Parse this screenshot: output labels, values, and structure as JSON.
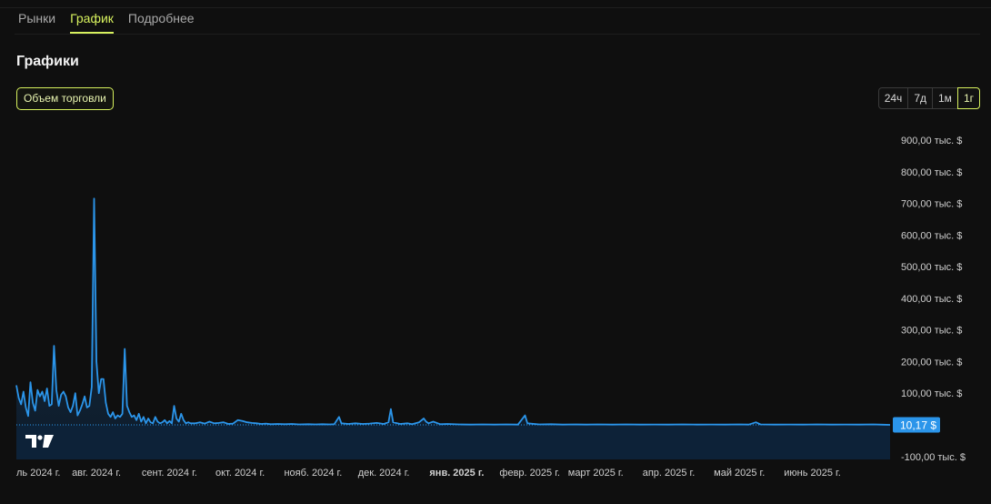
{
  "tabs": [
    {
      "label": "Рынки",
      "active": false
    },
    {
      "label": "График",
      "active": true
    },
    {
      "label": "Подробнее",
      "active": false
    }
  ],
  "section_title": "Графики",
  "metric_button": "Объем торговли",
  "ranges": [
    {
      "label": "24ч",
      "active": false
    },
    {
      "label": "7д",
      "active": false
    },
    {
      "label": "1м",
      "active": false
    },
    {
      "label": "1г",
      "active": true
    }
  ],
  "colors": {
    "accent": "#d7f15e",
    "line": "#2b95ea",
    "badge": "#2b95ea"
  },
  "chart_data": {
    "type": "area",
    "ylim": [
      -100000,
      950000
    ],
    "y_ticks": [
      {
        "value": 900000,
        "label": "900,00 тыс. $"
      },
      {
        "value": 800000,
        "label": "800,00 тыс. $"
      },
      {
        "value": 700000,
        "label": "700,00 тыс. $"
      },
      {
        "value": 600000,
        "label": "600,00 тыс. $"
      },
      {
        "value": 500000,
        "label": "500,00 тыс. $"
      },
      {
        "value": 400000,
        "label": "400,00 тыс. $"
      },
      {
        "value": 300000,
        "label": "300,00 тыс. $"
      },
      {
        "value": 200000,
        "label": "200,00 тыс. $"
      },
      {
        "value": 100000,
        "label": "100,00 тыс. $"
      },
      {
        "value": -100000,
        "label": "-100,00 тыс. $"
      }
    ],
    "x_ticks": [
      {
        "date": "2024-07-01",
        "label": "ль 2024 г.",
        "bold": false
      },
      {
        "date": "2024-08-01",
        "label": "авг. 2024 г.",
        "bold": false
      },
      {
        "date": "2024-09-01",
        "label": "сент. 2024 г.",
        "bold": false
      },
      {
        "date": "2024-10-01",
        "label": "окт. 2024 г.",
        "bold": false
      },
      {
        "date": "2024-11-01",
        "label": "нояб. 2024 г.",
        "bold": false
      },
      {
        "date": "2024-12-01",
        "label": "дек. 2024 г.",
        "bold": false
      },
      {
        "date": "2025-01-01",
        "label": "янв. 2025 г.",
        "bold": true
      },
      {
        "date": "2025-02-01",
        "label": "февр. 2025 г.",
        "bold": false
      },
      {
        "date": "2025-03-01",
        "label": "март 2025 г.",
        "bold": false
      },
      {
        "date": "2025-04-01",
        "label": "апр. 2025 г.",
        "bold": false
      },
      {
        "date": "2025-05-01",
        "label": "май 2025 г.",
        "bold": false
      },
      {
        "date": "2025-06-01",
        "label": "июнь 2025 г.",
        "bold": false
      }
    ],
    "last_value_label": "10,17 $",
    "last_value": 10.17,
    "series": [
      {
        "unit": "$",
        "points": [
          [
            "2024-06-28",
            125000
          ],
          [
            "2024-06-29",
            85000
          ],
          [
            "2024-06-30",
            65000
          ],
          [
            "2024-07-01",
            105000
          ],
          [
            "2024-07-02",
            55000
          ],
          [
            "2024-07-03",
            28000
          ],
          [
            "2024-07-04",
            135000
          ],
          [
            "2024-07-05",
            70000
          ],
          [
            "2024-07-06",
            45000
          ],
          [
            "2024-07-07",
            110000
          ],
          [
            "2024-07-08",
            90000
          ],
          [
            "2024-07-09",
            105000
          ],
          [
            "2024-07-10",
            75000
          ],
          [
            "2024-07-11",
            115000
          ],
          [
            "2024-07-12",
            60000
          ],
          [
            "2024-07-13",
            65000
          ],
          [
            "2024-07-14",
            250000
          ],
          [
            "2024-07-15",
            110000
          ],
          [
            "2024-07-16",
            60000
          ],
          [
            "2024-07-17",
            95000
          ],
          [
            "2024-07-18",
            105000
          ],
          [
            "2024-07-19",
            90000
          ],
          [
            "2024-07-20",
            55000
          ],
          [
            "2024-07-21",
            40000
          ],
          [
            "2024-07-22",
            60000
          ],
          [
            "2024-07-23",
            100000
          ],
          [
            "2024-07-24",
            30000
          ],
          [
            "2024-07-25",
            45000
          ],
          [
            "2024-07-26",
            65000
          ],
          [
            "2024-07-27",
            90000
          ],
          [
            "2024-07-28",
            55000
          ],
          [
            "2024-07-29",
            60000
          ],
          [
            "2024-07-30",
            120000
          ],
          [
            "2024-07-31",
            715000
          ],
          [
            "2024-08-01",
            200000
          ],
          [
            "2024-08-02",
            100000
          ],
          [
            "2024-08-03",
            145000
          ],
          [
            "2024-08-04",
            145000
          ],
          [
            "2024-08-05",
            70000
          ],
          [
            "2024-08-06",
            35000
          ],
          [
            "2024-08-07",
            25000
          ],
          [
            "2024-08-08",
            40000
          ],
          [
            "2024-08-09",
            20000
          ],
          [
            "2024-08-10",
            30000
          ],
          [
            "2024-08-11",
            25000
          ],
          [
            "2024-08-12",
            35000
          ],
          [
            "2024-08-13",
            240000
          ],
          [
            "2024-08-14",
            60000
          ],
          [
            "2024-08-15",
            40000
          ],
          [
            "2024-08-16",
            25000
          ],
          [
            "2024-08-17",
            30000
          ],
          [
            "2024-08-18",
            15000
          ],
          [
            "2024-08-19",
            35000
          ],
          [
            "2024-08-20",
            10000
          ],
          [
            "2024-08-21",
            25000
          ],
          [
            "2024-08-22",
            5000
          ],
          [
            "2024-08-23",
            20000
          ],
          [
            "2024-08-24",
            8000
          ],
          [
            "2024-08-25",
            5000
          ],
          [
            "2024-08-26",
            25000
          ],
          [
            "2024-08-27",
            10000
          ],
          [
            "2024-08-28",
            5000
          ],
          [
            "2024-08-29",
            8000
          ],
          [
            "2024-08-30",
            15000
          ],
          [
            "2024-08-31",
            5000
          ],
          [
            "2024-09-01",
            12000
          ],
          [
            "2024-09-02",
            5000
          ],
          [
            "2024-09-03",
            60000
          ],
          [
            "2024-09-04",
            20000
          ],
          [
            "2024-09-05",
            10000
          ],
          [
            "2024-09-06",
            35000
          ],
          [
            "2024-09-07",
            15000
          ],
          [
            "2024-09-08",
            5000
          ],
          [
            "2024-09-09",
            8000
          ],
          [
            "2024-09-10",
            5000
          ],
          [
            "2024-09-12",
            5000
          ],
          [
            "2024-09-14",
            8000
          ],
          [
            "2024-09-16",
            4000
          ],
          [
            "2024-09-18",
            10000
          ],
          [
            "2024-09-20",
            5000
          ],
          [
            "2024-09-22",
            6000
          ],
          [
            "2024-09-24",
            8000
          ],
          [
            "2024-09-26",
            3000
          ],
          [
            "2024-09-28",
            4000
          ],
          [
            "2024-09-30",
            15000
          ],
          [
            "2024-10-02",
            12000
          ],
          [
            "2024-10-04",
            8000
          ],
          [
            "2024-10-06",
            6000
          ],
          [
            "2024-10-08",
            5000
          ],
          [
            "2024-10-10",
            3000
          ],
          [
            "2024-10-12",
            4000
          ],
          [
            "2024-10-14",
            2000
          ],
          [
            "2024-10-17",
            3000
          ],
          [
            "2024-10-20",
            2000
          ],
          [
            "2024-10-23",
            3000
          ],
          [
            "2024-10-26",
            1500
          ],
          [
            "2024-10-30",
            2000
          ],
          [
            "2024-11-02",
            1500
          ],
          [
            "2024-11-05",
            2000
          ],
          [
            "2024-11-08",
            1500
          ],
          [
            "2024-11-10",
            2000
          ],
          [
            "2024-11-12",
            25000
          ],
          [
            "2024-11-13",
            5000
          ],
          [
            "2024-11-16",
            3000
          ],
          [
            "2024-11-19",
            5000
          ],
          [
            "2024-11-22",
            3000
          ],
          [
            "2024-11-25",
            4000
          ],
          [
            "2024-11-28",
            6000
          ],
          [
            "2024-12-01",
            3000
          ],
          [
            "2024-12-03",
            8000
          ],
          [
            "2024-12-04",
            50000
          ],
          [
            "2024-12-05",
            8000
          ],
          [
            "2024-12-08",
            3000
          ],
          [
            "2024-12-11",
            5000
          ],
          [
            "2024-12-13",
            2000
          ],
          [
            "2024-12-16",
            8000
          ],
          [
            "2024-12-18",
            20000
          ],
          [
            "2024-12-19",
            10000
          ],
          [
            "2024-12-20",
            5000
          ],
          [
            "2024-12-22",
            10000
          ],
          [
            "2024-12-25",
            2000
          ],
          [
            "2024-12-28",
            3000
          ],
          [
            "2025-01-02",
            1500
          ],
          [
            "2025-01-07",
            1000
          ],
          [
            "2025-01-12",
            1500
          ],
          [
            "2025-01-17",
            1000
          ],
          [
            "2025-01-22",
            1500
          ],
          [
            "2025-01-27",
            1000
          ],
          [
            "2025-01-30",
            30000
          ],
          [
            "2025-01-31",
            5000
          ],
          [
            "2025-02-05",
            1500
          ],
          [
            "2025-02-10",
            2000
          ],
          [
            "2025-02-15",
            1000
          ],
          [
            "2025-02-20",
            1500
          ],
          [
            "2025-02-25",
            1000
          ],
          [
            "2025-03-02",
            1500
          ],
          [
            "2025-03-08",
            1000
          ],
          [
            "2025-03-14",
            1500
          ],
          [
            "2025-03-20",
            1000
          ],
          [
            "2025-03-26",
            1200
          ],
          [
            "2025-04-01",
            1000
          ],
          [
            "2025-04-07",
            1500
          ],
          [
            "2025-04-13",
            1000
          ],
          [
            "2025-04-19",
            1200
          ],
          [
            "2025-04-25",
            1000
          ],
          [
            "2025-05-01",
            1500
          ],
          [
            "2025-05-05",
            1000
          ],
          [
            "2025-05-08",
            8000
          ],
          [
            "2025-05-10",
            1500
          ],
          [
            "2025-05-16",
            1000
          ],
          [
            "2025-05-22",
            1200
          ],
          [
            "2025-05-28",
            1000
          ],
          [
            "2025-06-03",
            1500
          ],
          [
            "2025-06-09",
            1000
          ],
          [
            "2025-06-15",
            1200
          ],
          [
            "2025-06-21",
            1000
          ],
          [
            "2025-06-27",
            1500
          ],
          [
            "2025-07-01",
            500
          ],
          [
            "2025-07-04",
            10.17
          ]
        ]
      }
    ]
  }
}
